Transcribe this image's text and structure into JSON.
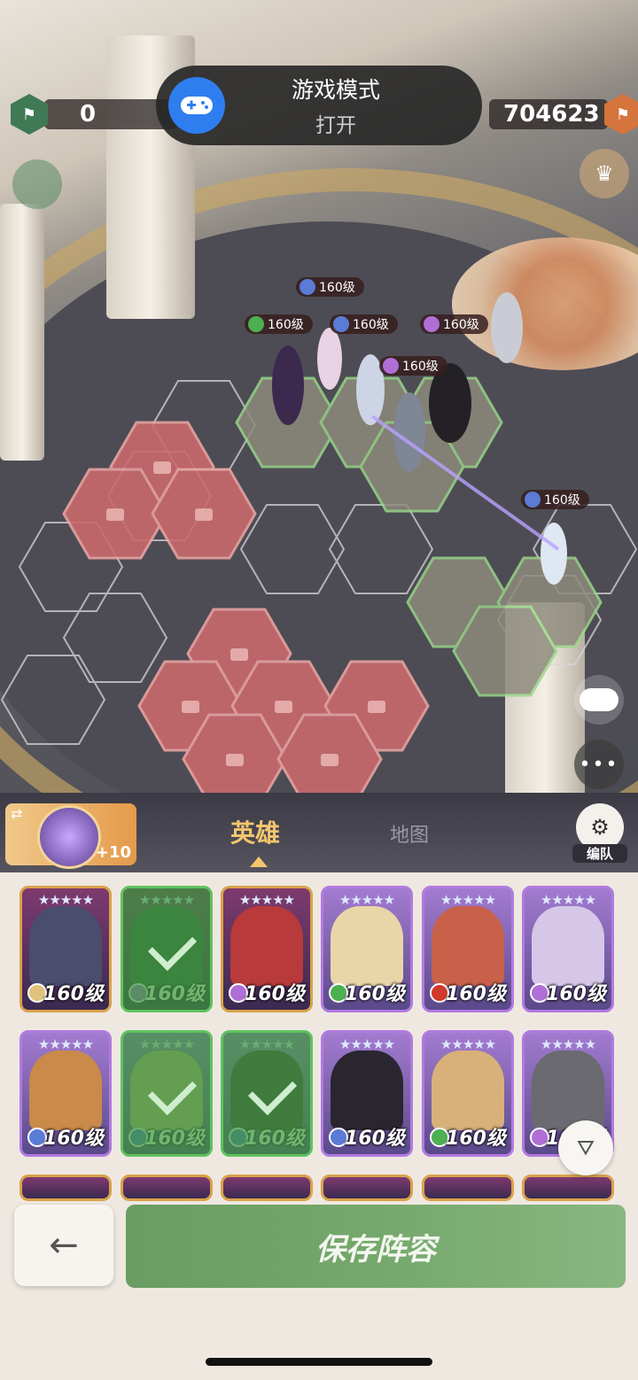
{
  "toast": {
    "title": "游戏模式",
    "status": "打开",
    "icon": "gamepad-icon"
  },
  "resources": {
    "left_value": "0",
    "right_value": "704623"
  },
  "battlefield": {
    "level_tags": [
      "160级",
      "160级",
      "160级",
      "160级",
      "160级",
      "160级"
    ]
  },
  "panel": {
    "tabs": [
      {
        "label": "英雄",
        "active": true
      },
      {
        "label": "地图",
        "active": false
      }
    ],
    "formation_label": "编队",
    "artifact_bonus": "+10",
    "filter_icon": "filter-icon",
    "save_label": "保存阵容",
    "back_icon": "arrow-left-icon"
  },
  "heroes": [
    {
      "level": "160级",
      "selected": false,
      "tier": "gold",
      "faction": "#e0c27a"
    },
    {
      "level": "160级",
      "selected": true,
      "tier": "gold",
      "faction": "#b06fd6"
    },
    {
      "level": "160级",
      "selected": false,
      "tier": "gold",
      "faction": "#b06fd6"
    },
    {
      "level": "160级",
      "selected": false,
      "tier": "purple",
      "faction": "#4caf50"
    },
    {
      "level": "160级",
      "selected": false,
      "tier": "purple",
      "faction": "#d0392b"
    },
    {
      "level": "160级",
      "selected": false,
      "tier": "purple",
      "faction": "#b06fd6"
    },
    {
      "level": "160级",
      "selected": false,
      "tier": "purple",
      "faction": "#5a7bd6"
    },
    {
      "level": "160级",
      "selected": true,
      "tier": "purple",
      "faction": "#5a7bd6"
    },
    {
      "level": "160级",
      "selected": true,
      "tier": "purple",
      "faction": "#5a7bd6"
    },
    {
      "level": "160级",
      "selected": false,
      "tier": "purple",
      "faction": "#5a7bd6"
    },
    {
      "level": "160级",
      "selected": false,
      "tier": "purple",
      "faction": "#4caf50"
    },
    {
      "level": "160级",
      "selected": false,
      "tier": "purple",
      "faction": "#b06fd6"
    }
  ]
}
